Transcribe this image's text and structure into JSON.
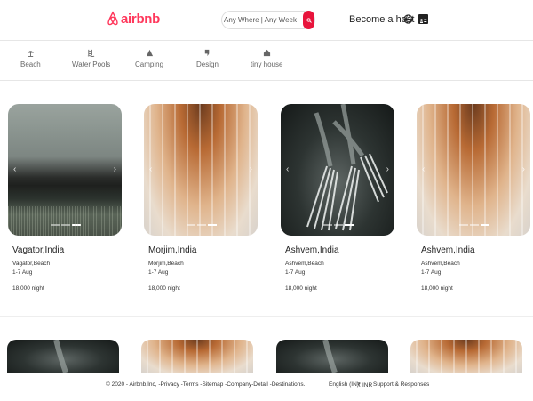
{
  "header": {
    "brand": "airbnb",
    "search_placeholder": "Any Where | Any Week",
    "host_label": "Become a host",
    "accent": "#ff385c"
  },
  "categories": [
    {
      "label": "Beach",
      "icon": "umbrella-icon"
    },
    {
      "label": "Water Pools",
      "icon": "pool-icon"
    },
    {
      "label": "Camping",
      "icon": "tent-icon"
    },
    {
      "label": "Design",
      "icon": "design-icon"
    },
    {
      "label": "tiny house",
      "icon": "house-icon"
    }
  ],
  "listings": [
    {
      "title": "Vagator,India",
      "type": "Vagator,Beach",
      "dates": "1-7 Aug",
      "price": "18,000 night",
      "image": "field"
    },
    {
      "title": "Morjim,India",
      "type": "Morjim,Beach",
      "dates": "1-7 Aug",
      "price": "18,000 night",
      "image": "arches"
    },
    {
      "title": "Ashvem,India",
      "type": "Ashvem,Beach",
      "dates": "1-7 Aug",
      "price": "18,000 night",
      "image": "forks"
    },
    {
      "title": "Ashvem,India",
      "type": "Ashvem,Beach",
      "dates": "1-7 Aug",
      "price": "18,000 night",
      "image": "arches"
    }
  ],
  "footer": {
    "copyright": "© 2020 - Airbnb,Inc, -Privacy -Terms -Sitemap -Company-Detail -Destinations.",
    "language": "English (IN)",
    "currency": "₹ INR",
    "support": "Support & Responses"
  }
}
